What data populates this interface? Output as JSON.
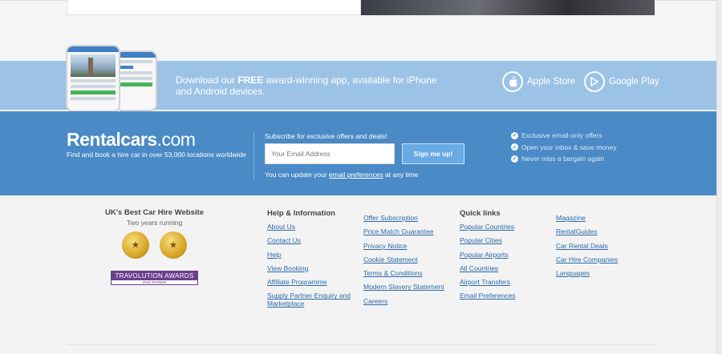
{
  "app_band": {
    "text_before": "Download our ",
    "text_bold": "FREE",
    "text_after": " award-winning app, available for iPhone and Android devices.",
    "apple_label": "Apple Store",
    "google_label": "Google Play",
    "apple_icon": "apple-icon",
    "google_icon": "play-icon"
  },
  "subscribe": {
    "logo_main": "Rentalcars",
    "logo_suffix": ".com",
    "tagline": "Find and book a hire car in over 53,000 locations worldwide",
    "heading": "Subscribe for exclusive offers and deals!",
    "email_placeholder": "Your Email Address",
    "button_label": "Sign me up!",
    "note_before": "You can update your ",
    "note_link": "email preferences",
    "note_after": " at any time",
    "benefits": [
      "Exclusive email-only offers",
      "Open your inbox & save money",
      "Never miss a bargain again"
    ]
  },
  "footer": {
    "award_title": "UK's Best Car Hire Website",
    "award_sub": "Two years running",
    "award_badge_top": "TRAVOLUTION AWARDS",
    "award_badge_bottom": "2015 WINNER",
    "columns": [
      {
        "heading": "Help & Information",
        "links": [
          "About Us",
          "Contact Us",
          "Help",
          "View Booking",
          "Affiliate Programme",
          "Supply Partner Enquiry and Marketplace"
        ]
      },
      {
        "heading": "",
        "links": [
          "Offer Subscription",
          "Price Match Guarantee",
          "Privacy Notice",
          "Cookie Statement",
          "Terms & Conditions",
          "Modern Slavery Statement",
          "Careers"
        ]
      },
      {
        "heading": "Quick links",
        "links": [
          "Popular Countries",
          "Popular Cities",
          "Popular Airports",
          "All Countries",
          "Airport Transfers",
          "Email Preferences"
        ]
      },
      {
        "heading": "",
        "links": [
          "Magazine",
          "RentalGuides",
          "Car Rental Deals",
          "Car Hire Companies",
          "Languages"
        ]
      }
    ]
  },
  "colors": {
    "app_band": "#9cc3e6",
    "subscribe_band": "#4a8ac6",
    "link": "#2a6aa8"
  }
}
